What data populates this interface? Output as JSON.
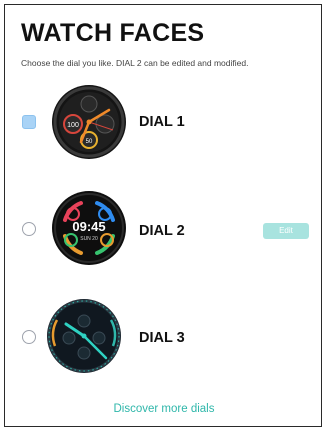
{
  "header": {
    "title": "WATCH FACES",
    "subtitle": "Choose the dial you like. DIAL 2 can be edited and modified."
  },
  "dials": [
    {
      "label": "DIAL 1",
      "selected": true,
      "face_text": [
        "100",
        "50"
      ]
    },
    {
      "label": "DIAL 2",
      "selected": false,
      "editable": true,
      "edit_label": "Edit",
      "time": "09:45",
      "date": "SUN 20"
    },
    {
      "label": "DIAL 3",
      "selected": false
    }
  ],
  "footer": {
    "discover_label": "Discover more dials"
  },
  "colors": {
    "accent": "#2fb7aa",
    "edit_button": "#a8e3df",
    "selected_radio": "#a9d3f6"
  },
  "icons": [
    "dial1-watch-face-icon",
    "dial2-watch-face-icon",
    "dial3-watch-face-icon"
  ]
}
